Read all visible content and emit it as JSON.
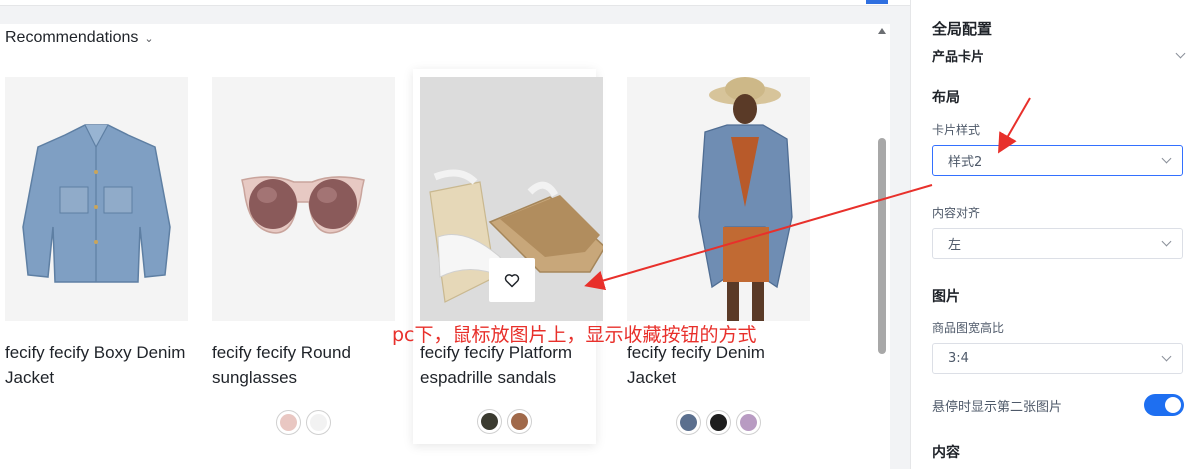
{
  "preview": {
    "title": "Recommendations",
    "annotation": "pc下，鼠标放图片上，显示收藏按钮的方式",
    "products": [
      {
        "name": "fecify fecify Boxy Denim Jacket",
        "swatches": []
      },
      {
        "name": "fecify fecify Round sunglasses",
        "swatches": [
          "#e9c7c2",
          "#f2f2f2"
        ]
      },
      {
        "name": "fecify fecify Platform espadrille sandals",
        "swatches": [
          "#3b3b30",
          "#a0694a"
        ]
      },
      {
        "name": "fecify fecify Denim Jacket",
        "swatches": [
          "#5b6f8e",
          "#1e1e1e",
          "#b89bc2"
        ]
      }
    ]
  },
  "panel": {
    "title": "全局配置",
    "section": "产品卡片",
    "layout_heading": "布局",
    "card_style_label": "卡片样式",
    "card_style_value": "样式2",
    "align_label": "内容对齐",
    "align_value": "左",
    "image_heading": "图片",
    "ratio_label": "商品图宽高比",
    "ratio_value": "3:4",
    "hover_label": "悬停时显示第二张图片",
    "hover_on": true,
    "content_heading": "内容"
  },
  "colors": {
    "accent": "#1e6ff1",
    "annotation": "#e8302b"
  }
}
